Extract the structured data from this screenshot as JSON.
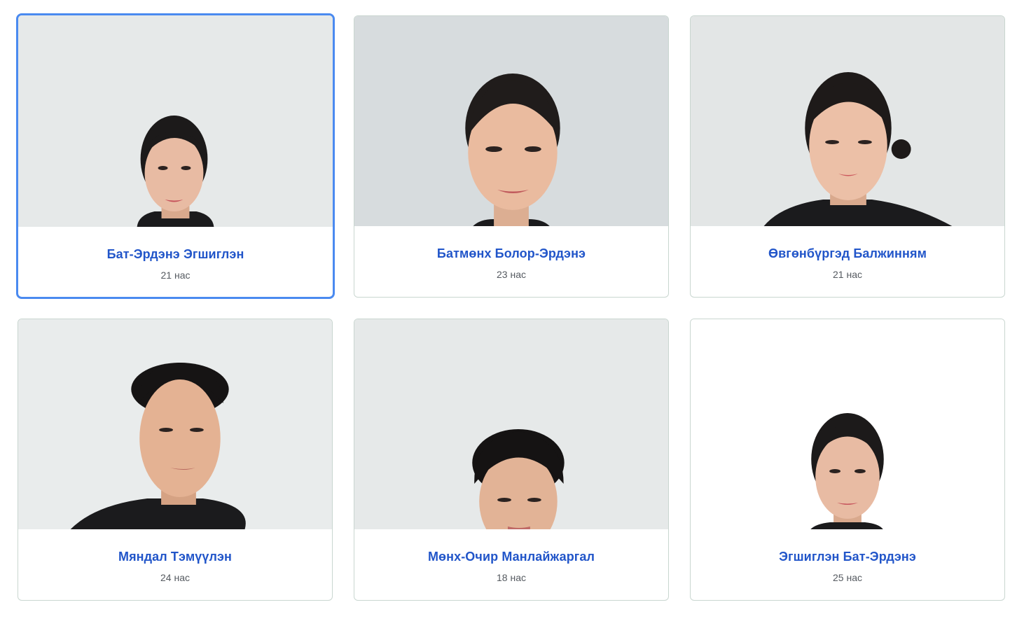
{
  "people": [
    {
      "name": "Бат-Эрдэнэ Эгшиглэн",
      "age": "21 нас",
      "photo_icon": "portrait-photo",
      "selected": true
    },
    {
      "name": "Батмөнх Болор-Эрдэнэ",
      "age": "23 нас",
      "photo_icon": "portrait-photo",
      "selected": false
    },
    {
      "name": "Өвгөнбүргэд Балжинням",
      "age": "21 нас",
      "photo_icon": "portrait-photo",
      "selected": false
    },
    {
      "name": "Мяндал Тэмүүлэн",
      "age": "24 нас",
      "photo_icon": "portrait-photo",
      "selected": false
    },
    {
      "name": "Мөнх-Очир Манлайжаргал",
      "age": "18 нас",
      "photo_icon": "portrait-photo",
      "selected": false
    },
    {
      "name": "Эгшиглэн Бат-Эрдэнэ",
      "age": "25 нас",
      "photo_icon": "portrait-photo",
      "selected": false
    }
  ],
  "colors": {
    "accent": "#4a8af0",
    "name_text": "#2155c9",
    "age_text": "#555a60",
    "card_border": "#c9d6d0"
  }
}
